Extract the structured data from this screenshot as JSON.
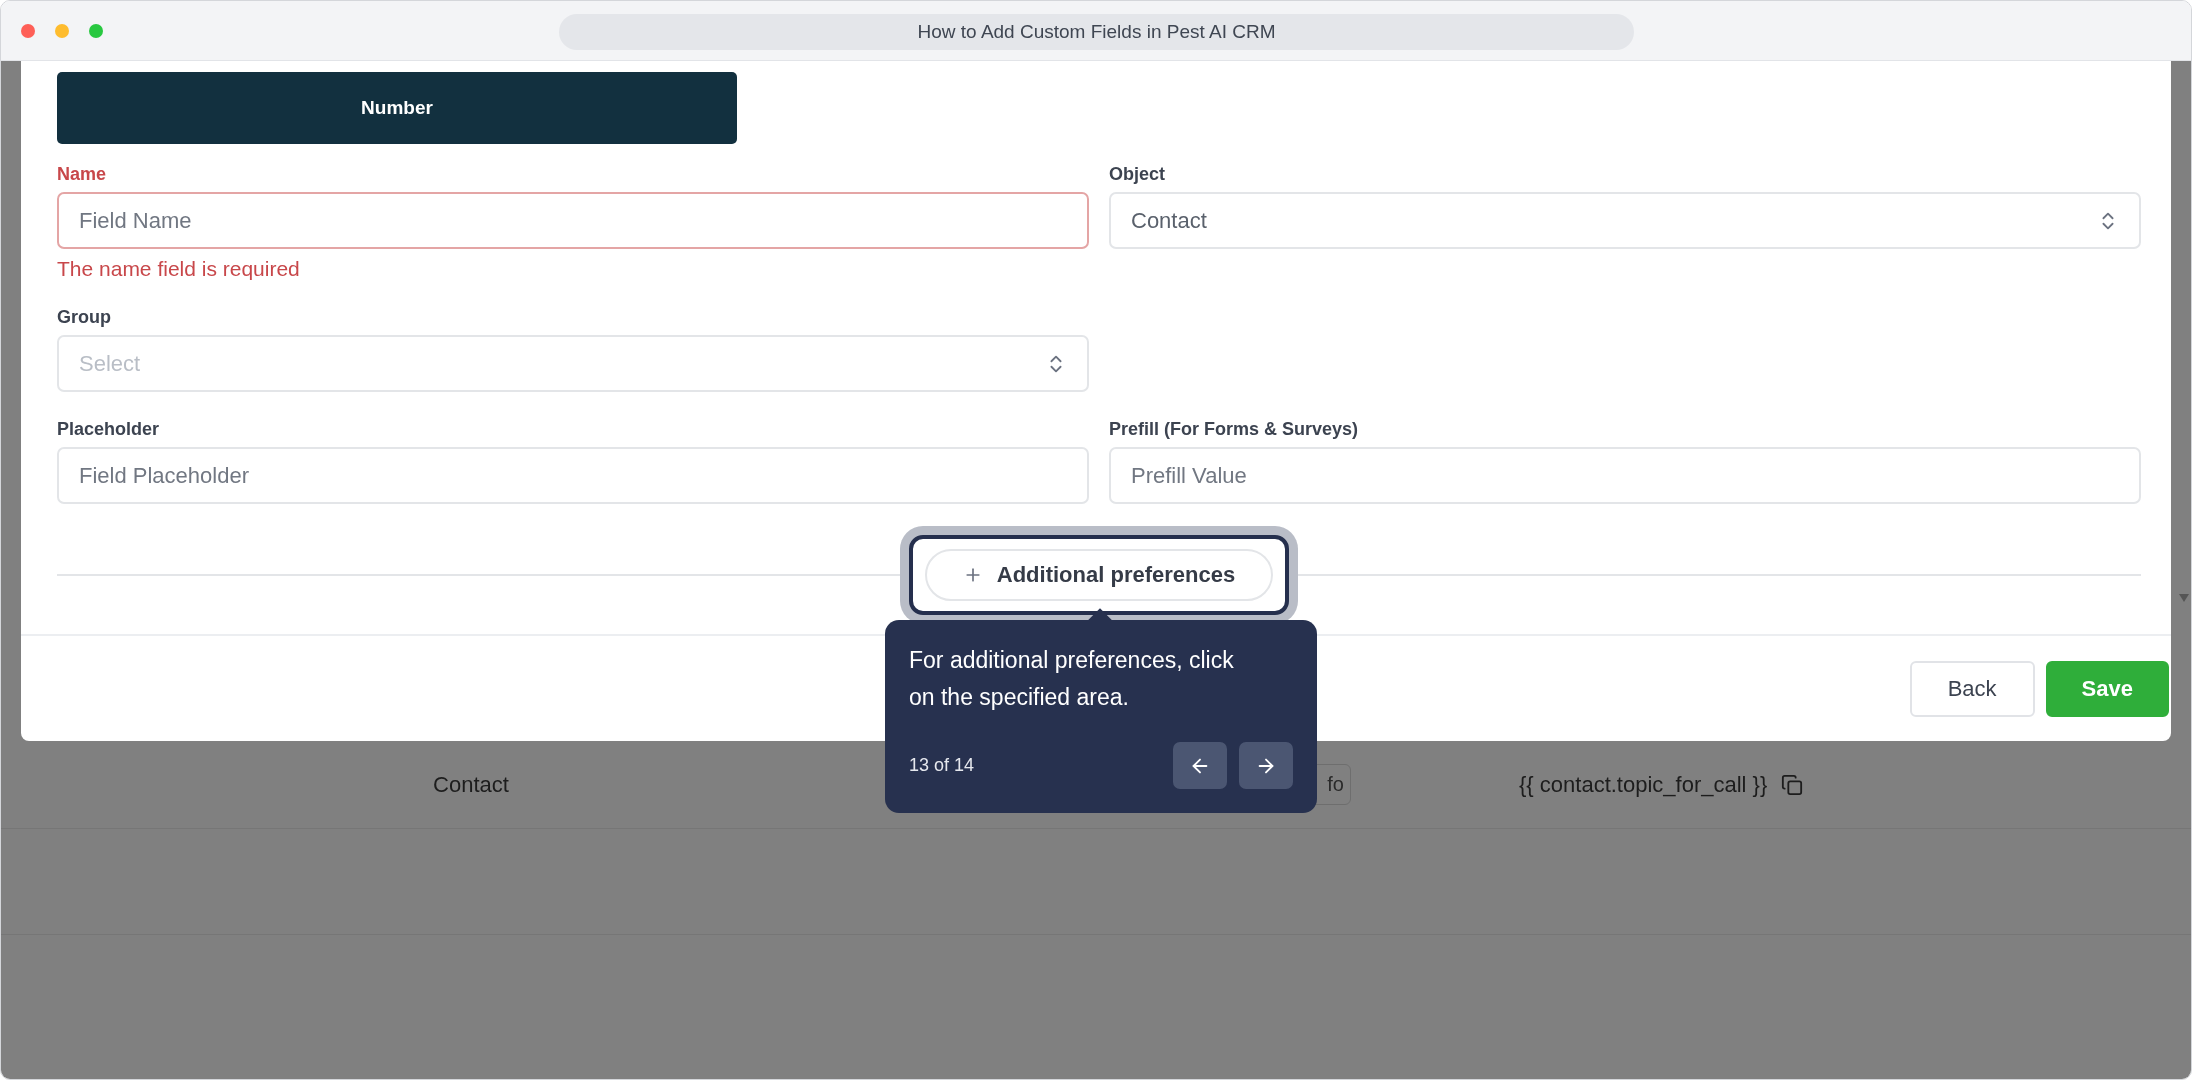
{
  "window": {
    "title": "How to Add Custom Fields in Pest AI CRM"
  },
  "type_button": {
    "label": "Number"
  },
  "form_rows": [
    [
      {
        "kind": "input",
        "label": "Name",
        "placeholder": "Field Name",
        "error": "The name field is required"
      },
      {
        "kind": "select",
        "label": "Object",
        "value": "Contact"
      }
    ],
    [
      {
        "kind": "select",
        "label": "Group",
        "placeholder": "Select"
      }
    ],
    [
      {
        "kind": "input",
        "label": "Placeholder",
        "placeholder": "Field Placeholder"
      },
      {
        "kind": "input",
        "label": "Prefill (For Forms & Surveys)",
        "placeholder": "Prefill Value"
      }
    ]
  ],
  "additional_button": {
    "label": "Additional preferences"
  },
  "footer_buttons": [
    {
      "label": "Back",
      "kind": "secondary"
    },
    {
      "label": "Save",
      "kind": "primary"
    }
  ],
  "background_rows": [
    {
      "object": "Contact",
      "badge": "fo",
      "merge_tag": "{{ contact.topic_for_call }}"
    }
  ],
  "tour": {
    "text": "For additional preferences, click on the specified area.",
    "step": "13 of 14"
  }
}
